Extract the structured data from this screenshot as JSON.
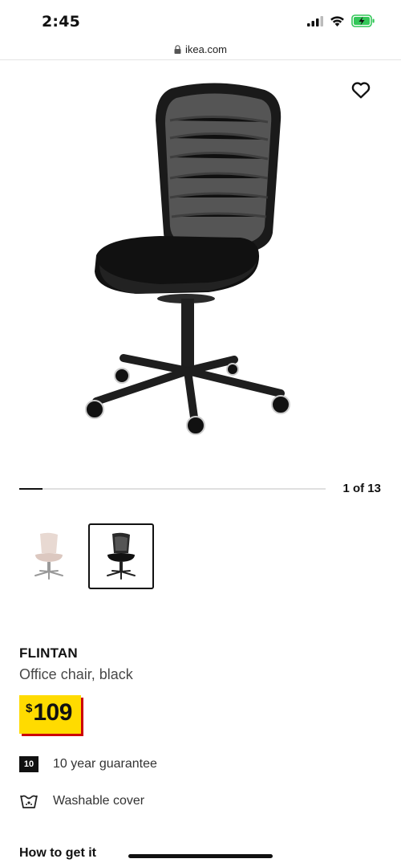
{
  "status_bar": {
    "time": "2:45",
    "icons": [
      "cellular-signal-icon",
      "wifi-icon",
      "battery-charging-icon"
    ]
  },
  "browser": {
    "url": "ikea.com"
  },
  "gallery": {
    "counter": "1 of 13",
    "current_index": 1,
    "total": 13
  },
  "thumbnails": [
    {
      "name": "beige-chair-variant",
      "selected": false
    },
    {
      "name": "black-chair-variant",
      "selected": true
    }
  ],
  "product": {
    "name": "FLINTAN",
    "description": "Office chair, black",
    "price_symbol": "$",
    "price_value": "109"
  },
  "features": [
    {
      "icon": "10",
      "label": "10 year guarantee"
    },
    {
      "icon": "washable-icon",
      "label": "Washable cover"
    }
  ],
  "section": {
    "how_to_get_it": "How to get it"
  },
  "colors": {
    "price_yellow": "#ffdb00",
    "price_red": "#cc0008",
    "battery_green": "#34c759"
  }
}
